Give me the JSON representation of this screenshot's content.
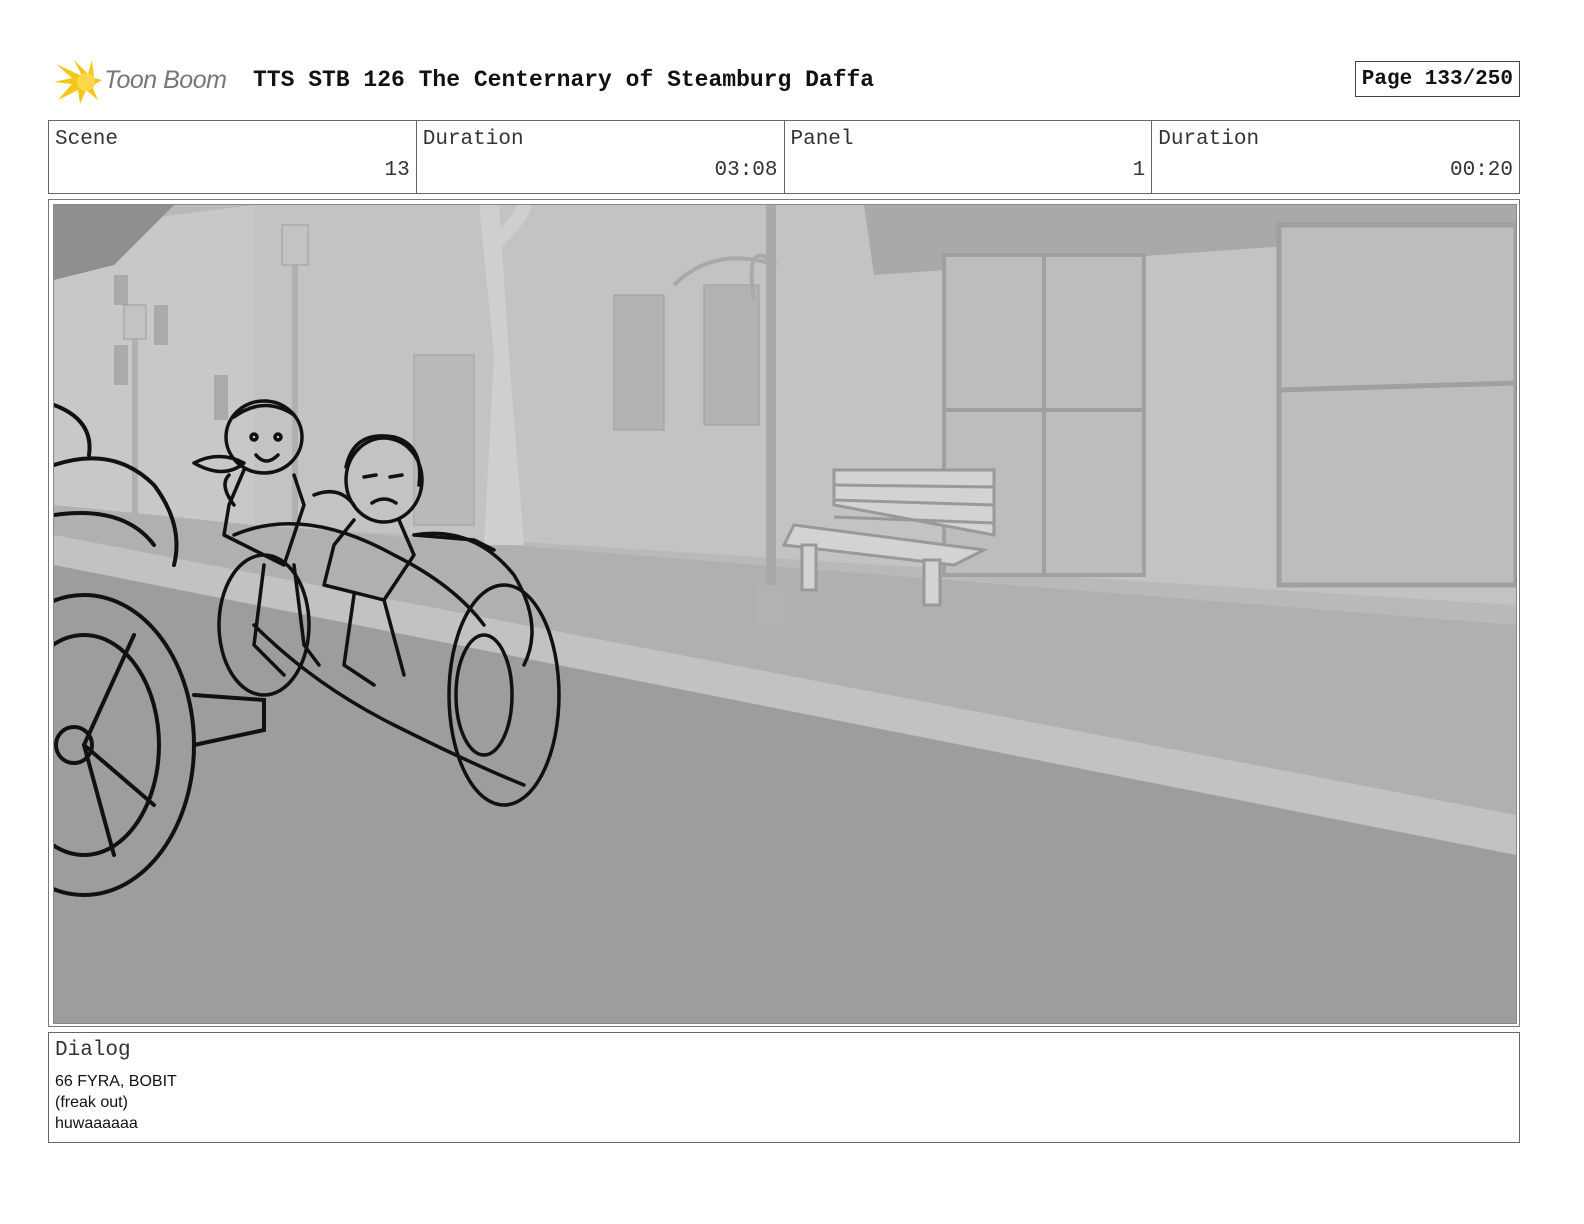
{
  "header": {
    "logo_text": "Toon Boom",
    "title": "TTS STB 126 The Centernary of Steamburg Daffa",
    "page": "Page 133/250"
  },
  "info": {
    "scene_label": "Scene",
    "scene_value": "13",
    "scene_duration_label": "Duration",
    "scene_duration_value": "03:08",
    "panel_label": "Panel",
    "panel_value": "1",
    "panel_duration_label": "Duration",
    "panel_duration_value": "00:20"
  },
  "dialog": {
    "label": "Dialog",
    "lines": [
      "66 FYRA, BOBIT",
      "(freak out)",
      "huwaaaaaa"
    ]
  },
  "colors": {
    "logo_star": "#f5c518",
    "panel_bg": "#b8b8b8",
    "road": "#9d9d9f",
    "sketch_line": "#111111"
  }
}
